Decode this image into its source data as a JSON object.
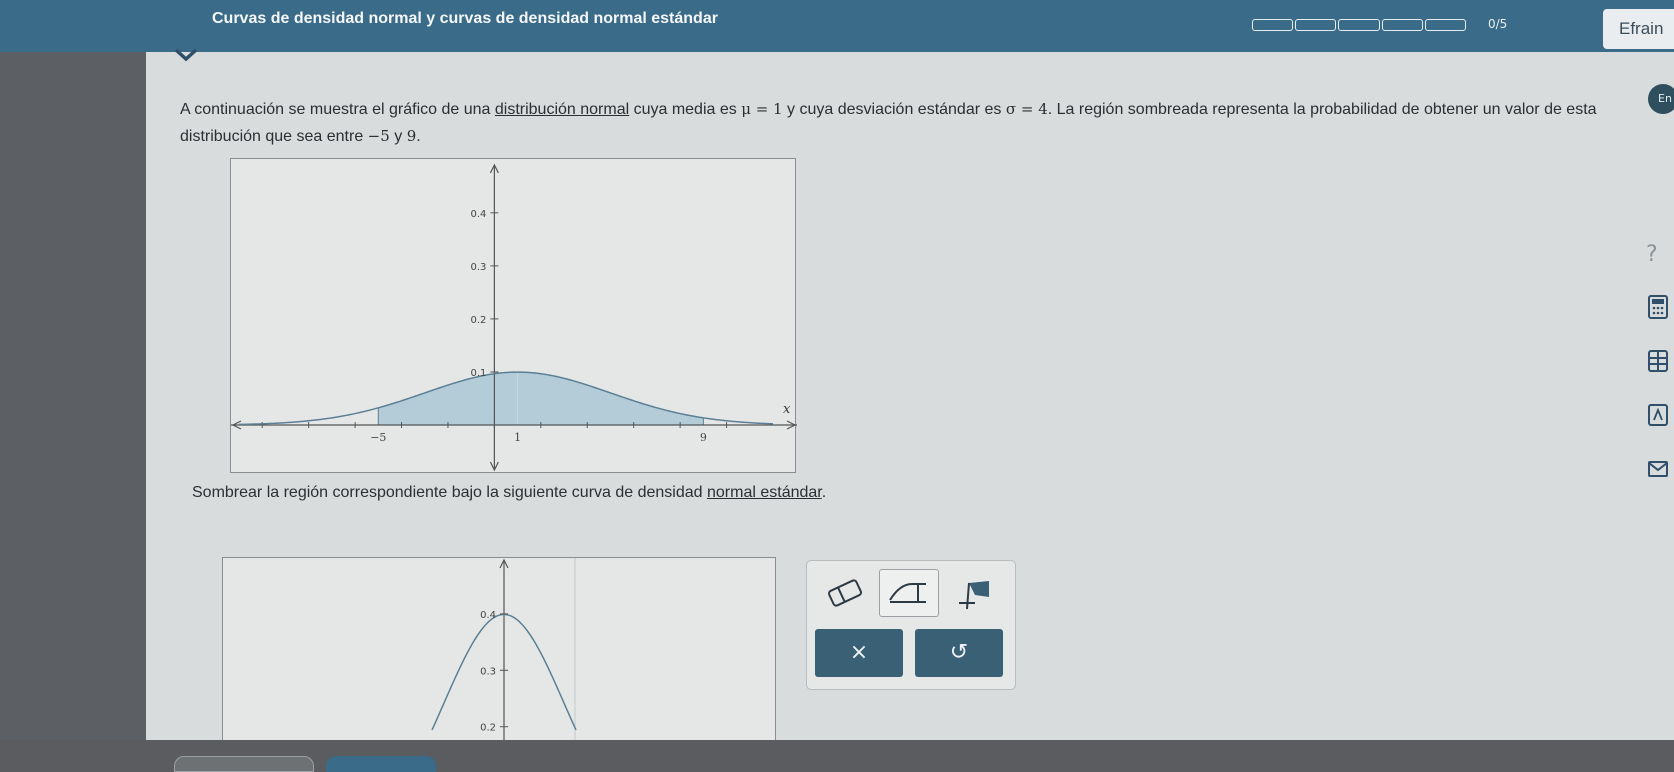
{
  "header": {
    "topic_title": "Curvas de densidad normal y curvas de densidad normal estándar",
    "progress": {
      "completed": 0,
      "total": 5,
      "label": "0/5"
    },
    "user_name": "Efrain",
    "colors": {
      "bar": "#3a6b88",
      "accent": "#3a6076"
    }
  },
  "side": {
    "lang_badge": "En",
    "help_glyph": "?"
  },
  "prompt": {
    "p1": "A continuación se muestra el gráfico de una ",
    "link": "distribución normal",
    "p2": " cuya media es ",
    "mu": "μ = 1",
    "p3": " y cuya desviación estándar es ",
    "sigma": "σ = 4",
    "p4": ". La región sombreada representa la probabilidad de obtener un valor de esta distribución que sea entre ",
    "a": "−5",
    "p5": " y ",
    "b": "9",
    "p6": "."
  },
  "instruction": {
    "text": "Sombrear la región correspondiente bajo la siguiente curva de densidad ",
    "link": "normal estándar",
    "end": "."
  },
  "chart_data": [
    {
      "type": "area",
      "distribution": "normal",
      "mean": 1,
      "sd": 4,
      "shaded_range": [
        -5,
        9
      ],
      "x_labels": [
        "−5",
        "1",
        "9"
      ],
      "x_axis_label": "x",
      "y_ticks": [
        "0.1",
        "0.2",
        "0.3",
        "0.4"
      ],
      "xlim": [
        -11,
        12
      ],
      "ylim": [
        0,
        0.46
      ],
      "colors": {
        "fill": "#b3ccd8",
        "curve": "#5b7f95"
      }
    },
    {
      "type": "line",
      "distribution": "normal",
      "mean": 0,
      "sd": 1,
      "y_ticks": [
        "0.2",
        "0.3",
        "0.4"
      ],
      "xlim": [
        -4,
        4
      ],
      "ylim": [
        0.18,
        0.46
      ]
    }
  ],
  "tools": {
    "eraser": "eraser-tool",
    "line": "line-tool",
    "fill": "fill-tool",
    "clear_glyph": "×",
    "undo_glyph": "↺"
  }
}
